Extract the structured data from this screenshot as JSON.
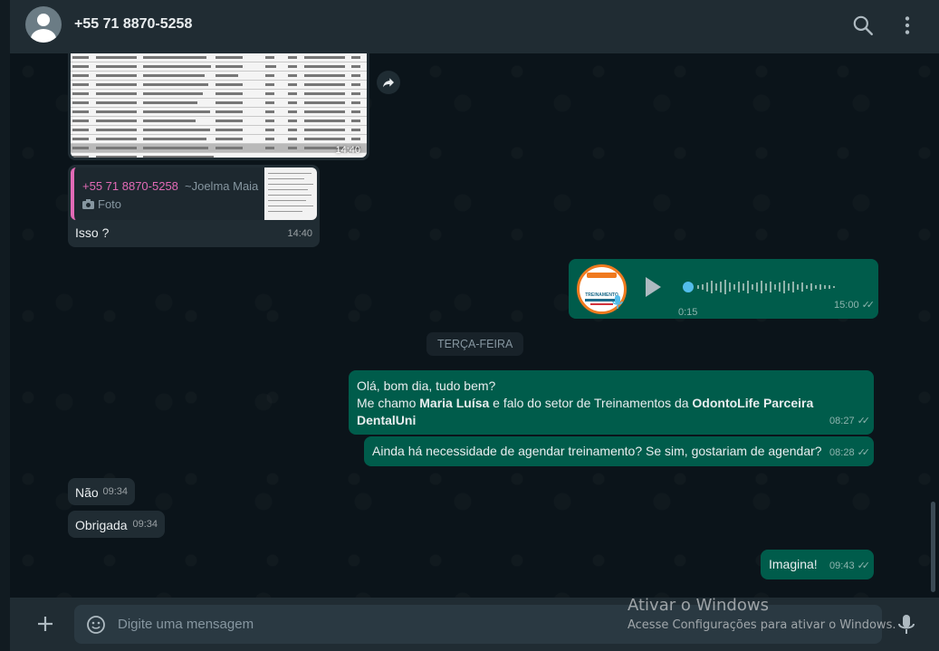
{
  "header": {
    "contact_name": "+55 71 8870-5258",
    "icons": [
      "avatar",
      "search-icon",
      "menu-dots-icon"
    ]
  },
  "image_message": {
    "time": "14:40"
  },
  "reply_message": {
    "quote_name": "+55 71 8870-5258",
    "quote_author": "~Joelma Maia",
    "quote_type": "Foto",
    "text": "Isso ?",
    "time": "14:40"
  },
  "audio_message": {
    "duration": "0:15",
    "time": "15:00",
    "avatar_text": "TREINAMENTO"
  },
  "day_separator": "TERÇA-FEIRA",
  "messages": {
    "hello": {
      "line1": "Olá, bom dia, tudo bem?",
      "line2_a": "Me chamo ",
      "line2_name": "Maria Luísa",
      "line2_b": " e falo do setor de Treinamentos da ",
      "line2_company": "OdontoLife Parceira DentalUni",
      "time": "08:27"
    },
    "need": {
      "text": "Ainda há necessidade de agendar treinamento? Se sim, gostariam de agendar?",
      "time": "08:28"
    },
    "nao": {
      "text": "Não",
      "time": "09:34"
    },
    "obrigada": {
      "text": "Obrigada",
      "time": "09:34"
    },
    "imagina": {
      "text": "Imagina!",
      "time": "09:43"
    }
  },
  "footer": {
    "placeholder": "Digite uma mensagem"
  },
  "activation": {
    "title": "Ativar o Windows",
    "subtitle": "Acesse Configurações para ativar o Windows."
  },
  "colors": {
    "incoming": "#202c33",
    "outgoing": "#005c4b",
    "background": "#0b141a",
    "quote_accent": "#e26ab6"
  }
}
